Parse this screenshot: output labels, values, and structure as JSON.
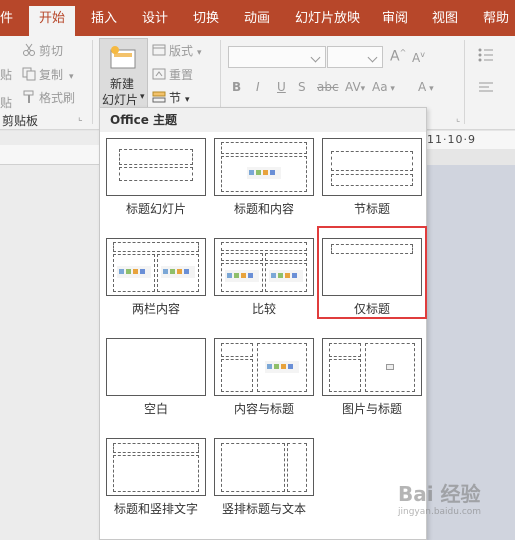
{
  "tabs": [
    {
      "label": "件",
      "active": false
    },
    {
      "label": "开始",
      "active": true
    },
    {
      "label": "插入",
      "active": false
    },
    {
      "label": "设计",
      "active": false
    },
    {
      "label": "切换",
      "active": false
    },
    {
      "label": "动画",
      "active": false
    },
    {
      "label": "幻灯片放映",
      "active": false
    },
    {
      "label": "审阅",
      "active": false
    },
    {
      "label": "视图",
      "active": false
    },
    {
      "label": "帮助",
      "active": false
    }
  ],
  "ribbon": {
    "cut": "剪切",
    "copy": "复制",
    "format_painter": "格式刷",
    "paste_partial": "贴",
    "clipboard_group": "剪贴板",
    "new_slide_line1": "新建",
    "new_slide_line2": "幻灯片",
    "layout": "版式",
    "reset": "重置",
    "section": "节",
    "font_grow": "A",
    "font_shrink": "A",
    "bold": "B",
    "italic": "I",
    "underline": "U",
    "shadow": "S",
    "strike": "abc",
    "spacing": "AV",
    "case": "Aa",
    "font_color": "A"
  },
  "ruler_text": "11·10·9",
  "dropdown": {
    "header": "Office 主题",
    "layouts": [
      {
        "name": "标题幻灯片",
        "selected": false
      },
      {
        "name": "标题和内容",
        "selected": false
      },
      {
        "name": "节标题",
        "selected": false
      },
      {
        "name": "两栏内容",
        "selected": false
      },
      {
        "name": "比较",
        "selected": false
      },
      {
        "name": "仅标题",
        "selected": true
      },
      {
        "name": "空白",
        "selected": false
      },
      {
        "name": "内容与标题",
        "selected": false
      },
      {
        "name": "图片与标题",
        "selected": false
      },
      {
        "name": "标题和竖排文字",
        "selected": false
      },
      {
        "name": "竖排标题与文本",
        "selected": false
      }
    ]
  },
  "watermark": "Bai 经验",
  "watermark_url": "jingyan.baidu.com",
  "colors": {
    "accent": "#b7472a",
    "highlight": "#e03c3c"
  }
}
